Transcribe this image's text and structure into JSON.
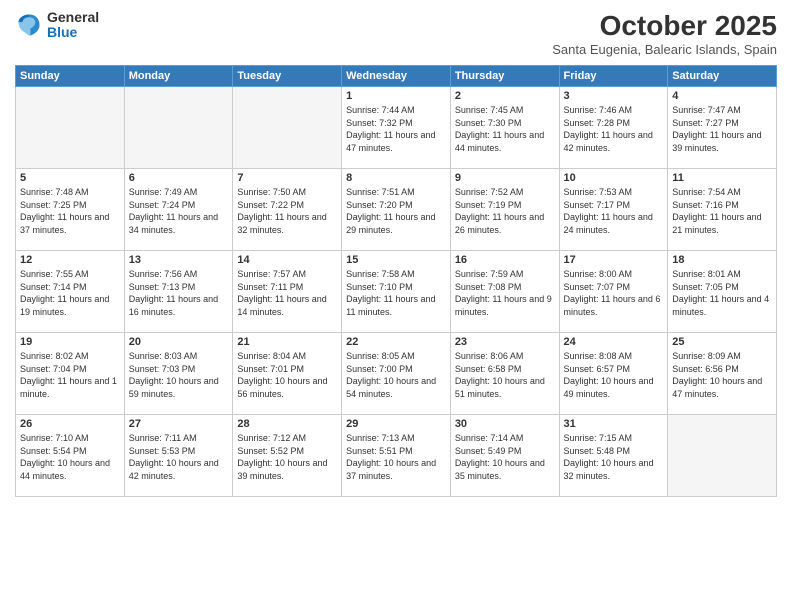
{
  "logo": {
    "general": "General",
    "blue": "Blue"
  },
  "header": {
    "month": "October 2025",
    "location": "Santa Eugenia, Balearic Islands, Spain"
  },
  "weekdays": [
    "Sunday",
    "Monday",
    "Tuesday",
    "Wednesday",
    "Thursday",
    "Friday",
    "Saturday"
  ],
  "weeks": [
    [
      {
        "day": "",
        "info": ""
      },
      {
        "day": "",
        "info": ""
      },
      {
        "day": "",
        "info": ""
      },
      {
        "day": "1",
        "info": "Sunrise: 7:44 AM\nSunset: 7:32 PM\nDaylight: 11 hours and 47 minutes."
      },
      {
        "day": "2",
        "info": "Sunrise: 7:45 AM\nSunset: 7:30 PM\nDaylight: 11 hours and 44 minutes."
      },
      {
        "day": "3",
        "info": "Sunrise: 7:46 AM\nSunset: 7:28 PM\nDaylight: 11 hours and 42 minutes."
      },
      {
        "day": "4",
        "info": "Sunrise: 7:47 AM\nSunset: 7:27 PM\nDaylight: 11 hours and 39 minutes."
      }
    ],
    [
      {
        "day": "5",
        "info": "Sunrise: 7:48 AM\nSunset: 7:25 PM\nDaylight: 11 hours and 37 minutes."
      },
      {
        "day": "6",
        "info": "Sunrise: 7:49 AM\nSunset: 7:24 PM\nDaylight: 11 hours and 34 minutes."
      },
      {
        "day": "7",
        "info": "Sunrise: 7:50 AM\nSunset: 7:22 PM\nDaylight: 11 hours and 32 minutes."
      },
      {
        "day": "8",
        "info": "Sunrise: 7:51 AM\nSunset: 7:20 PM\nDaylight: 11 hours and 29 minutes."
      },
      {
        "day": "9",
        "info": "Sunrise: 7:52 AM\nSunset: 7:19 PM\nDaylight: 11 hours and 26 minutes."
      },
      {
        "day": "10",
        "info": "Sunrise: 7:53 AM\nSunset: 7:17 PM\nDaylight: 11 hours and 24 minutes."
      },
      {
        "day": "11",
        "info": "Sunrise: 7:54 AM\nSunset: 7:16 PM\nDaylight: 11 hours and 21 minutes."
      }
    ],
    [
      {
        "day": "12",
        "info": "Sunrise: 7:55 AM\nSunset: 7:14 PM\nDaylight: 11 hours and 19 minutes."
      },
      {
        "day": "13",
        "info": "Sunrise: 7:56 AM\nSunset: 7:13 PM\nDaylight: 11 hours and 16 minutes."
      },
      {
        "day": "14",
        "info": "Sunrise: 7:57 AM\nSunset: 7:11 PM\nDaylight: 11 hours and 14 minutes."
      },
      {
        "day": "15",
        "info": "Sunrise: 7:58 AM\nSunset: 7:10 PM\nDaylight: 11 hours and 11 minutes."
      },
      {
        "day": "16",
        "info": "Sunrise: 7:59 AM\nSunset: 7:08 PM\nDaylight: 11 hours and 9 minutes."
      },
      {
        "day": "17",
        "info": "Sunrise: 8:00 AM\nSunset: 7:07 PM\nDaylight: 11 hours and 6 minutes."
      },
      {
        "day": "18",
        "info": "Sunrise: 8:01 AM\nSunset: 7:05 PM\nDaylight: 11 hours and 4 minutes."
      }
    ],
    [
      {
        "day": "19",
        "info": "Sunrise: 8:02 AM\nSunset: 7:04 PM\nDaylight: 11 hours and 1 minute."
      },
      {
        "day": "20",
        "info": "Sunrise: 8:03 AM\nSunset: 7:03 PM\nDaylight: 10 hours and 59 minutes."
      },
      {
        "day": "21",
        "info": "Sunrise: 8:04 AM\nSunset: 7:01 PM\nDaylight: 10 hours and 56 minutes."
      },
      {
        "day": "22",
        "info": "Sunrise: 8:05 AM\nSunset: 7:00 PM\nDaylight: 10 hours and 54 minutes."
      },
      {
        "day": "23",
        "info": "Sunrise: 8:06 AM\nSunset: 6:58 PM\nDaylight: 10 hours and 51 minutes."
      },
      {
        "day": "24",
        "info": "Sunrise: 8:08 AM\nSunset: 6:57 PM\nDaylight: 10 hours and 49 minutes."
      },
      {
        "day": "25",
        "info": "Sunrise: 8:09 AM\nSunset: 6:56 PM\nDaylight: 10 hours and 47 minutes."
      }
    ],
    [
      {
        "day": "26",
        "info": "Sunrise: 7:10 AM\nSunset: 5:54 PM\nDaylight: 10 hours and 44 minutes."
      },
      {
        "day": "27",
        "info": "Sunrise: 7:11 AM\nSunset: 5:53 PM\nDaylight: 10 hours and 42 minutes."
      },
      {
        "day": "28",
        "info": "Sunrise: 7:12 AM\nSunset: 5:52 PM\nDaylight: 10 hours and 39 minutes."
      },
      {
        "day": "29",
        "info": "Sunrise: 7:13 AM\nSunset: 5:51 PM\nDaylight: 10 hours and 37 minutes."
      },
      {
        "day": "30",
        "info": "Sunrise: 7:14 AM\nSunset: 5:49 PM\nDaylight: 10 hours and 35 minutes."
      },
      {
        "day": "31",
        "info": "Sunrise: 7:15 AM\nSunset: 5:48 PM\nDaylight: 10 hours and 32 minutes."
      },
      {
        "day": "",
        "info": ""
      }
    ]
  ]
}
